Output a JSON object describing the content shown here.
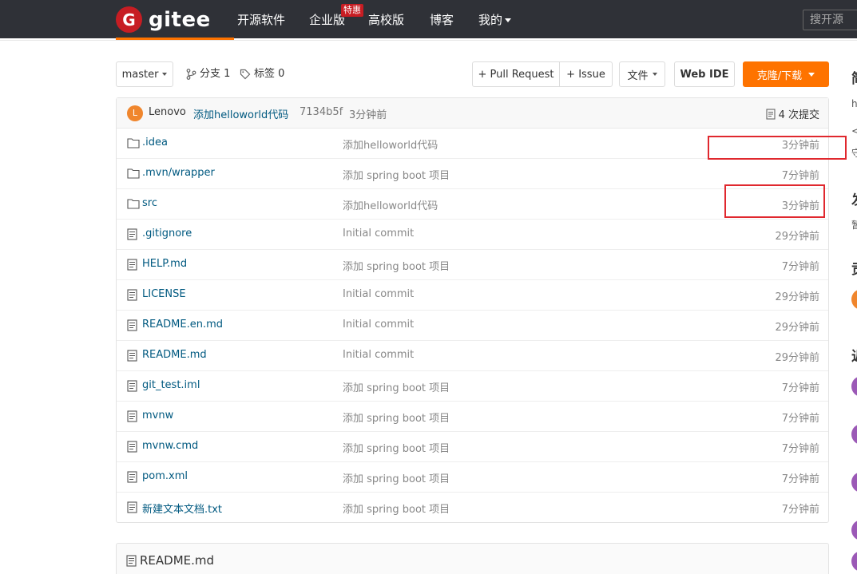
{
  "nav": {
    "logo_mark": "G",
    "logo_text": "gitee",
    "items": [
      "开源软件",
      "企业版",
      "高校版",
      "博客",
      "我的"
    ],
    "badge": "特惠",
    "search_placeholder": "搜开源"
  },
  "toolbar": {
    "branch": "master",
    "branches": "分支 1",
    "tags": "标签 0",
    "pull_request": "+ Pull Request",
    "issue": "+ Issue",
    "file_menu": "文件",
    "web_ide": "Web IDE",
    "clone": "克隆/下载"
  },
  "commit": {
    "avatar_letter": "L",
    "author": "Lenovo",
    "message": "添加helloworld代码",
    "hash": "7134b5f",
    "time": "3分钟前",
    "count": "4 次提交"
  },
  "files": [
    {
      "name": ".idea",
      "type": "folder",
      "message": "添加helloworld代码",
      "time": "3分钟前"
    },
    {
      "name": ".mvn/wrapper",
      "type": "folder",
      "message": "添加 spring boot 项目",
      "time": "7分钟前"
    },
    {
      "name": "src",
      "type": "folder",
      "message": "添加helloworld代码",
      "time": "3分钟前"
    },
    {
      "name": ".gitignore",
      "type": "file",
      "message": "Initial commit",
      "time": "29分钟前"
    },
    {
      "name": "HELP.md",
      "type": "file",
      "message": "添加 spring boot 项目",
      "time": "7分钟前"
    },
    {
      "name": "LICENSE",
      "type": "file",
      "message": "Initial commit",
      "time": "29分钟前"
    },
    {
      "name": "README.en.md",
      "type": "file",
      "message": "Initial commit",
      "time": "29分钟前"
    },
    {
      "name": "README.md",
      "type": "file",
      "message": "Initial commit",
      "time": "29分钟前"
    },
    {
      "name": "git_test.iml",
      "type": "file",
      "message": "添加 spring boot 项目",
      "time": "7分钟前"
    },
    {
      "name": "mvnw",
      "type": "file",
      "message": "添加 spring boot 项目",
      "time": "7分钟前"
    },
    {
      "name": "mvnw.cmd",
      "type": "file",
      "message": "添加 spring boot 项目",
      "time": "7分钟前"
    },
    {
      "name": "pom.xml",
      "type": "file",
      "message": "添加 spring boot 项目",
      "time": "7分钟前"
    },
    {
      "name": "新建文本文档.txt",
      "type": "file",
      "message": "添加 spring boot 项目",
      "time": "7分钟前"
    }
  ],
  "readme": {
    "title": "README.md"
  },
  "sidebar": {
    "glyphs": [
      "简",
      "发",
      "贡",
      "近"
    ],
    "snippets": [
      "h",
      "<",
      "守",
      "暂"
    ]
  },
  "colors": {
    "nav_bg": "#2f3137",
    "brand_red": "#c71d23",
    "clone_orange": "#fe7300",
    "link_blue": "#005980",
    "annotation_red": "#e0282e"
  },
  "icons": {
    "folder": "folder-icon",
    "file": "file-icon",
    "branch": "branch-icon",
    "tag": "tag-icon",
    "commits": "commits-icon"
  }
}
